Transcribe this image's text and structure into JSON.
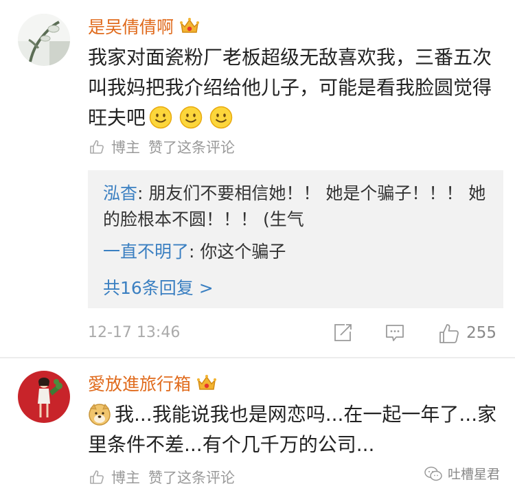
{
  "comments": [
    {
      "username": "是吴倩倩啊",
      "badge_icon": "crown-vip-icon",
      "text": "我家对面瓷粉厂老板超级无敌喜欢我，三番五次叫我妈把我介绍给他儿子，可能是看我脸圆觉得旺夫吧",
      "emoji_count": 3,
      "emoji_icon": "smile-emoji-icon",
      "author_like_label": "博主",
      "author_like_text": "赞了这条评论",
      "replies": [
        {
          "name": "泓杳",
          "sep": ": ",
          "text": "朋友们不要相信她！！ 她是个骗子！！！ 她的脸根本不圆！！！ (生气"
        },
        {
          "name": "一直不明了",
          "sep": ": ",
          "text": "你这个骗子"
        }
      ],
      "more_replies": "共16条回复 >",
      "timestamp": "12-17 13:46",
      "like_count": "255"
    },
    {
      "username": "愛放進旅行箱",
      "badge_icon": "crown-vip-icon",
      "emoji_icon": "doge-emoji-icon",
      "text": "我...我能说我也是网恋吗...在一起一年了...家里条件不差...有个几千万的公司...",
      "author_like_label": "博主",
      "author_like_text": "赞了这条评论"
    }
  ],
  "watermark": {
    "icon": "wechat-icon",
    "text": "吐槽星君"
  },
  "colors": {
    "username": "#e06b1d",
    "reply_name": "#3a7fc1",
    "reply_bg": "#f2f2f2",
    "meta": "#aaaaaa"
  }
}
